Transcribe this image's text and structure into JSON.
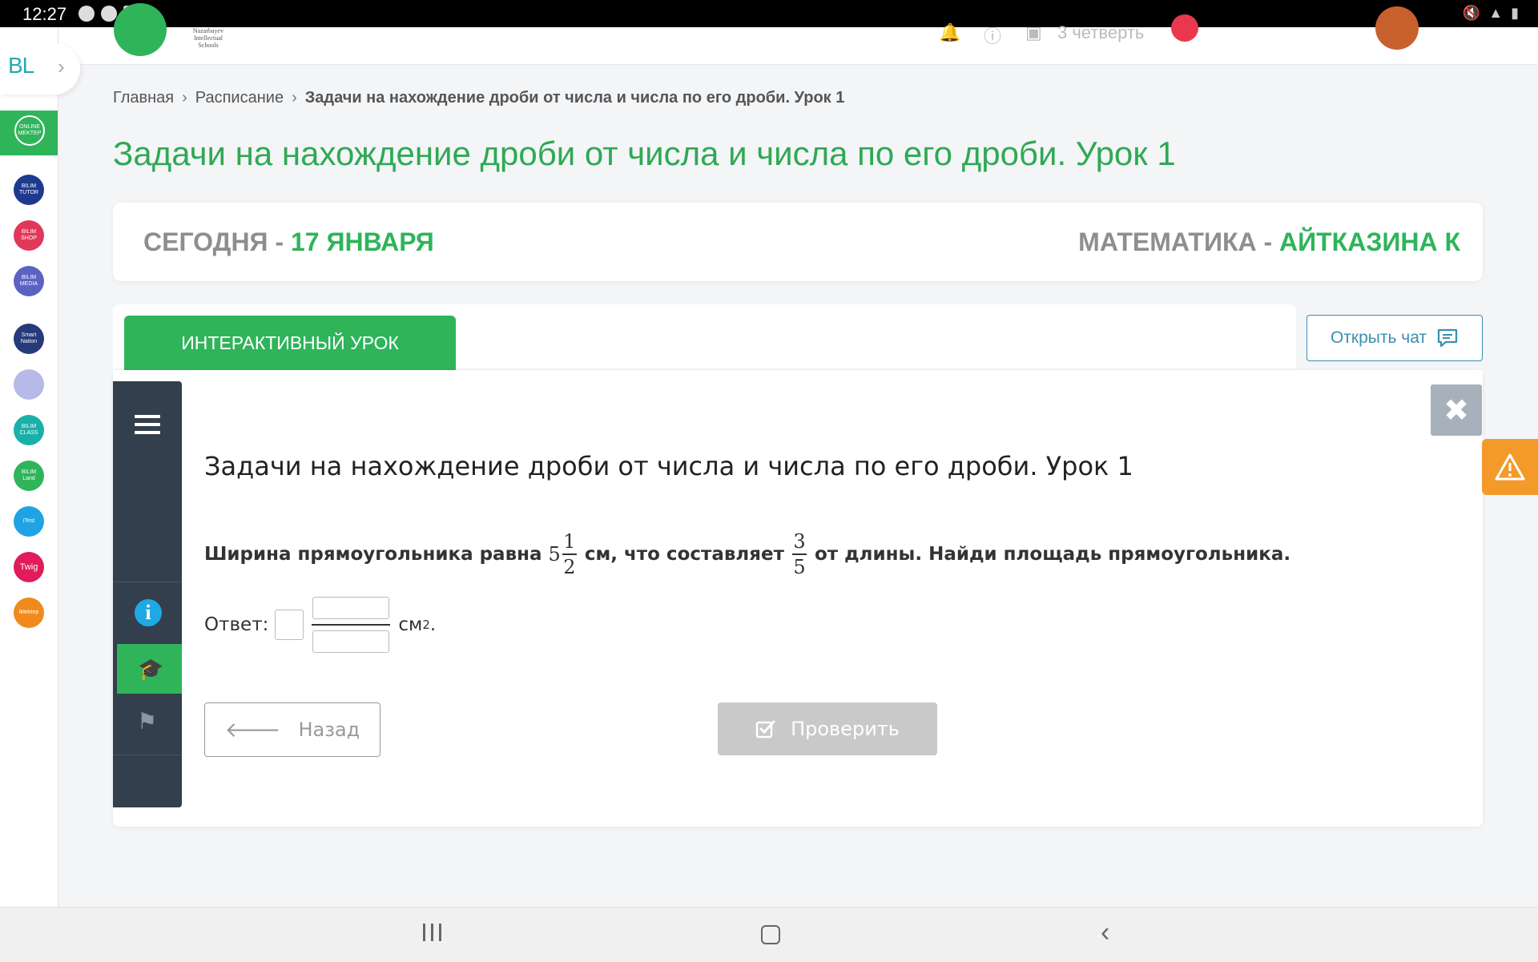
{
  "status_bar": {
    "time": "12:27"
  },
  "rail": {
    "brand": "BL",
    "items": [
      {
        "label": "ONLINE\nMEKTEP",
        "color": "#2fb45a"
      },
      {
        "label": "BILIM\nTUTOR",
        "color": "#1d3a8f"
      },
      {
        "label": "BILIM\nSHOP",
        "color": "#e0385a"
      },
      {
        "label": "BILIM\nMEDIA",
        "color": "#5c62c4"
      },
      {
        "label": "Smart\nNation",
        "color": "#263a7a"
      },
      {
        "label": "",
        "color": "#b7b9e6"
      },
      {
        "label": "BILIM\nCLASS",
        "color": "#19b0a9"
      },
      {
        "label": "BILIM\nLand",
        "color": "#2fb45a"
      },
      {
        "label": "iTest",
        "color": "#1fa3e4"
      },
      {
        "label": "Twig",
        "color": "#e01c5a"
      },
      {
        "label": "iMektep",
        "color": "#f08a1a"
      }
    ]
  },
  "header": {
    "school_line1": "Nazarbayev",
    "school_line2": "Intellectual",
    "school_line3": "Schools",
    "quarter": "3 четверть"
  },
  "breadcrumb": {
    "home": "Главная",
    "schedule": "Расписание",
    "current": "Задачи на нахождение дроби от числа и числа по его дроби. Урок 1"
  },
  "page_title": "Задачи на нахождение дроби от числа и числа по его дроби. Урок 1",
  "date_card": {
    "today_label": "СЕГОДНЯ - ",
    "today_date": "17 ЯНВАРЯ",
    "subject": "МАТЕМАТИКА - ",
    "teacher": "АЙТКАЗИНА К"
  },
  "tab": {
    "label": "ИНТЕРАКТИВНЫЙ УРОК"
  },
  "chat_button": {
    "label": "Открыть чат"
  },
  "lesson": {
    "title": "Задачи на нахождение дроби от числа и числа по его дроби. Урок 1",
    "question_part1": "Ширина прямоугольника равна",
    "width_whole": "5",
    "width_num": "1",
    "width_den": "2",
    "question_part2": "см, что составляет",
    "ratio_num": "3",
    "ratio_den": "5",
    "question_part3": "от длины. Найди площадь прямоугольника.",
    "answer_label": "Ответ:",
    "answer_unit": "см",
    "answer_unit_power": "2",
    "answer_end": "."
  },
  "buttons": {
    "back": "Назад",
    "check": "Проверить"
  },
  "colors": {
    "accent": "#2fb45a",
    "sidebar_dark": "#333f4d",
    "chat_blue": "#3a8fb0",
    "warning": "#f39a2b"
  }
}
